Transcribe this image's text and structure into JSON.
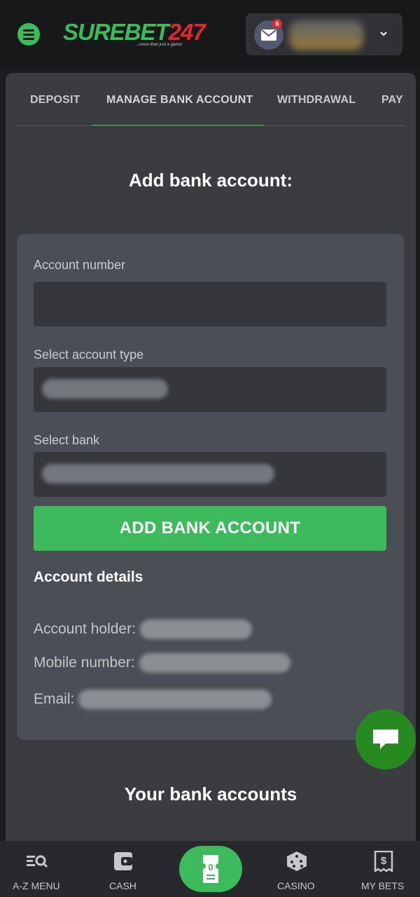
{
  "header": {
    "logo_main": "SUREBET247",
    "logo_tagline": "...more than just a game!",
    "mail_badge": "6"
  },
  "tabs": [
    "DEPOSIT",
    "MANAGE BANK ACCOUNT",
    "WITHDRAWAL",
    "PAYMENTS"
  ],
  "tab_visible": [
    "DEPOSIT",
    "MANAGE BANK ACCOUNT",
    "WITHDRAWAL",
    "PAYI"
  ],
  "form": {
    "title": "Add bank account:",
    "account_number_label": "Account number",
    "account_type_label": "Select account type",
    "bank_label": "Select bank",
    "submit_label": "ADD BANK ACCOUNT"
  },
  "details": {
    "title": "Account details",
    "holder_label": "Account holder:",
    "mobile_label": "Mobile number:",
    "email_label": "Email:"
  },
  "your_accounts_title": "Your bank accounts",
  "bottom_nav": {
    "az_menu": "A-Z MENU",
    "cash": "CASH",
    "betslip_count": "0",
    "casino": "CASINO",
    "my_bets": "MY BETS"
  },
  "colors": {
    "accent": "#3dba5c",
    "brand_red": "#e0282d",
    "chat": "#278a20"
  }
}
